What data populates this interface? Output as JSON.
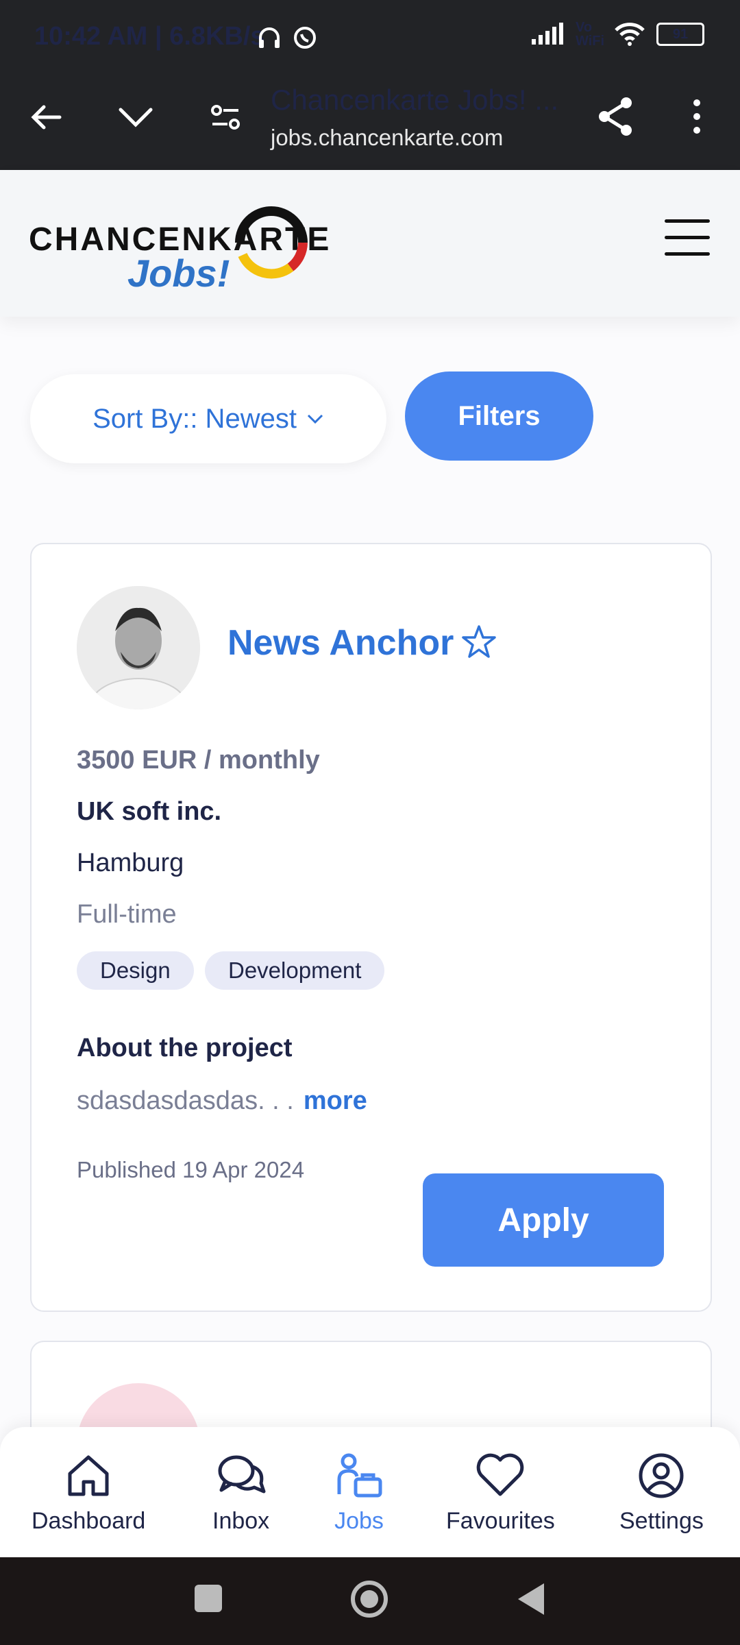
{
  "status": {
    "time": "10:42 AM | 6.8KB/s",
    "network": "Vo WiFi",
    "battery": "91"
  },
  "browser": {
    "title": "Chancenkarte Jobs! ...",
    "host": "jobs.chancenkarte.com"
  },
  "logo": {
    "brand": "CHANCENKARTE",
    "sub": "Jobs!"
  },
  "controls": {
    "sort_label": "Sort By:: Newest",
    "filters_label": "Filters"
  },
  "job": {
    "title": "News Anchor",
    "salary": "3500 EUR / monthly",
    "company": "UK soft inc.",
    "city": "Hamburg",
    "type": "Full-time",
    "tags": [
      "Design",
      "Development"
    ],
    "about_title": "About the project",
    "about_text": "sdasdasdasdas. . .",
    "about_more": "more",
    "published": "Published 19 Apr 2024",
    "apply_label": "Apply"
  },
  "nav": {
    "items": [
      {
        "label": "Dashboard",
        "icon": "home-icon"
      },
      {
        "label": "Inbox",
        "icon": "chat-icon"
      },
      {
        "label": "Jobs",
        "icon": "jobs-icon"
      },
      {
        "label": "Favourites",
        "icon": "heart-icon"
      },
      {
        "label": "Settings",
        "icon": "user-circle-icon"
      }
    ],
    "active": "Jobs"
  },
  "colors": {
    "accent": "#4a87f0",
    "link": "#2f73d8",
    "dark_bar": "#222326"
  }
}
